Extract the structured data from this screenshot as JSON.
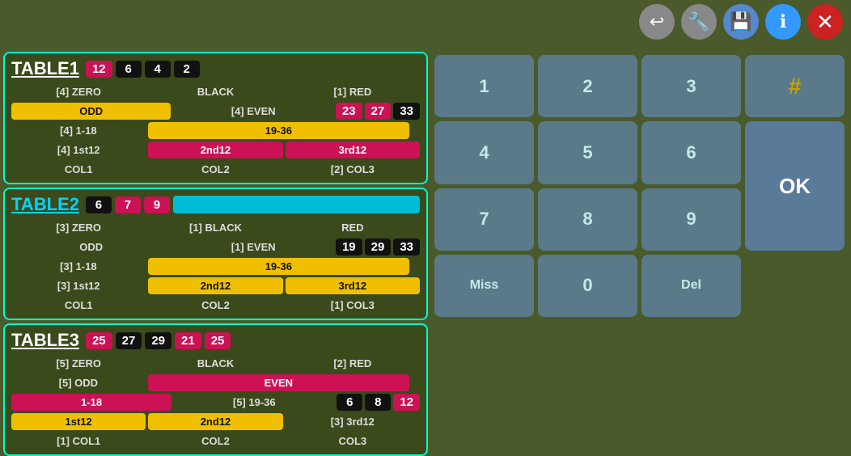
{
  "toolbar": {
    "back_label": "↩",
    "wrench_label": "🔧",
    "save_label": "💾",
    "info_label": "ℹ",
    "close_label": "✕"
  },
  "table1": {
    "title": "TABLE1",
    "header_numbers": [
      "12",
      "6",
      "4",
      "2"
    ],
    "header_colors": [
      "pink",
      "black",
      "black",
      "black"
    ],
    "rows": [
      {
        "cells": [
          {
            "text": "[4] ZERO",
            "style": "transparent"
          },
          {
            "text": "BLACK",
            "style": "transparent"
          },
          {
            "text": "[1] RED",
            "style": "transparent"
          }
        ]
      },
      {
        "cells": [
          {
            "text": "ODD",
            "style": "yellow"
          },
          {
            "text": "[4] EVEN",
            "style": "transparent"
          },
          {
            "text": "",
            "style": "transparent"
          }
        ],
        "extra_nums": [
          {
            "text": "23",
            "style": "pink"
          },
          {
            "text": "27",
            "style": "pink"
          },
          {
            "text": "33",
            "style": "black"
          }
        ]
      },
      {
        "cells": [
          {
            "text": "[4] 1-18",
            "style": "transparent"
          },
          {
            "text": "19-36",
            "style": "yellow"
          },
          {
            "text": "",
            "style": "transparent"
          }
        ]
      },
      {
        "cells": [
          {
            "text": "[4] 1st12",
            "style": "transparent"
          },
          {
            "text": "2nd12",
            "style": "pink"
          },
          {
            "text": "3rd12",
            "style": "pink"
          }
        ]
      },
      {
        "cells": [
          {
            "text": "COL1",
            "style": "transparent"
          },
          {
            "text": "COL2",
            "style": "transparent"
          },
          {
            "text": "[2] COL3",
            "style": "transparent"
          }
        ]
      }
    ]
  },
  "table2": {
    "title": "TABLE2",
    "header_numbers": [
      "6",
      "7",
      "9"
    ],
    "header_colors": [
      "black",
      "pink",
      "pink"
    ],
    "rows": [
      {
        "cells": [
          {
            "text": "[3] ZERO",
            "style": "transparent"
          },
          {
            "text": "[1] BLACK",
            "style": "transparent"
          },
          {
            "text": "RED",
            "style": "transparent"
          }
        ]
      },
      {
        "cells": [
          {
            "text": "ODD",
            "style": "transparent"
          },
          {
            "text": "[1] EVEN",
            "style": "transparent"
          },
          {
            "text": "",
            "style": "transparent"
          }
        ],
        "extra_nums": [
          {
            "text": "19",
            "style": "black"
          },
          {
            "text": "29",
            "style": "black"
          },
          {
            "text": "33",
            "style": "black"
          }
        ]
      },
      {
        "cells": [
          {
            "text": "[3] 1-18",
            "style": "transparent"
          },
          {
            "text": "19-36",
            "style": "yellow"
          },
          {
            "text": "",
            "style": "transparent"
          }
        ]
      },
      {
        "cells": [
          {
            "text": "[3] 1st12",
            "style": "transparent"
          },
          {
            "text": "2nd12",
            "style": "yellow"
          },
          {
            "text": "3rd12",
            "style": "yellow"
          }
        ]
      },
      {
        "cells": [
          {
            "text": "COL1",
            "style": "transparent"
          },
          {
            "text": "COL2",
            "style": "transparent"
          },
          {
            "text": "[1] COL3",
            "style": "transparent"
          }
        ]
      }
    ]
  },
  "table3": {
    "title": "TABLE3",
    "header_numbers": [
      "25",
      "27",
      "29",
      "21",
      "25"
    ],
    "header_colors": [
      "pink",
      "black",
      "black",
      "pink",
      "pink"
    ],
    "rows": [
      {
        "cells": [
          {
            "text": "[5] ZERO",
            "style": "transparent"
          },
          {
            "text": "BLACK",
            "style": "transparent"
          },
          {
            "text": "[2] RED",
            "style": "transparent"
          }
        ]
      },
      {
        "cells": [
          {
            "text": "[5] ODD",
            "style": "transparent"
          },
          {
            "text": "EVEN",
            "style": "pink"
          },
          {
            "text": "",
            "style": "transparent"
          }
        ]
      },
      {
        "cells": [
          {
            "text": "1-18",
            "style": "pink"
          },
          {
            "text": "[5] 19-36",
            "style": "transparent"
          },
          {
            "text": "",
            "style": "transparent"
          }
        ],
        "extra_nums": [
          {
            "text": "6",
            "style": "black"
          },
          {
            "text": "8",
            "style": "black"
          },
          {
            "text": "12",
            "style": "pink"
          }
        ]
      },
      {
        "cells": [
          {
            "text": "1st12",
            "style": "yellow"
          },
          {
            "text": "2nd12",
            "style": "yellow"
          },
          {
            "text": "[3] 3rd12",
            "style": "transparent"
          }
        ]
      },
      {
        "cells": [
          {
            "text": "[1] COL1",
            "style": "transparent"
          },
          {
            "text": "COL2",
            "style": "transparent"
          },
          {
            "text": "COL3",
            "style": "transparent"
          }
        ]
      }
    ]
  },
  "keypad": {
    "keys": [
      "1",
      "2",
      "3",
      "4",
      "5",
      "6",
      "7",
      "8",
      "9",
      "Miss",
      "0",
      "Del"
    ],
    "hash": "#",
    "ok": "OK"
  }
}
